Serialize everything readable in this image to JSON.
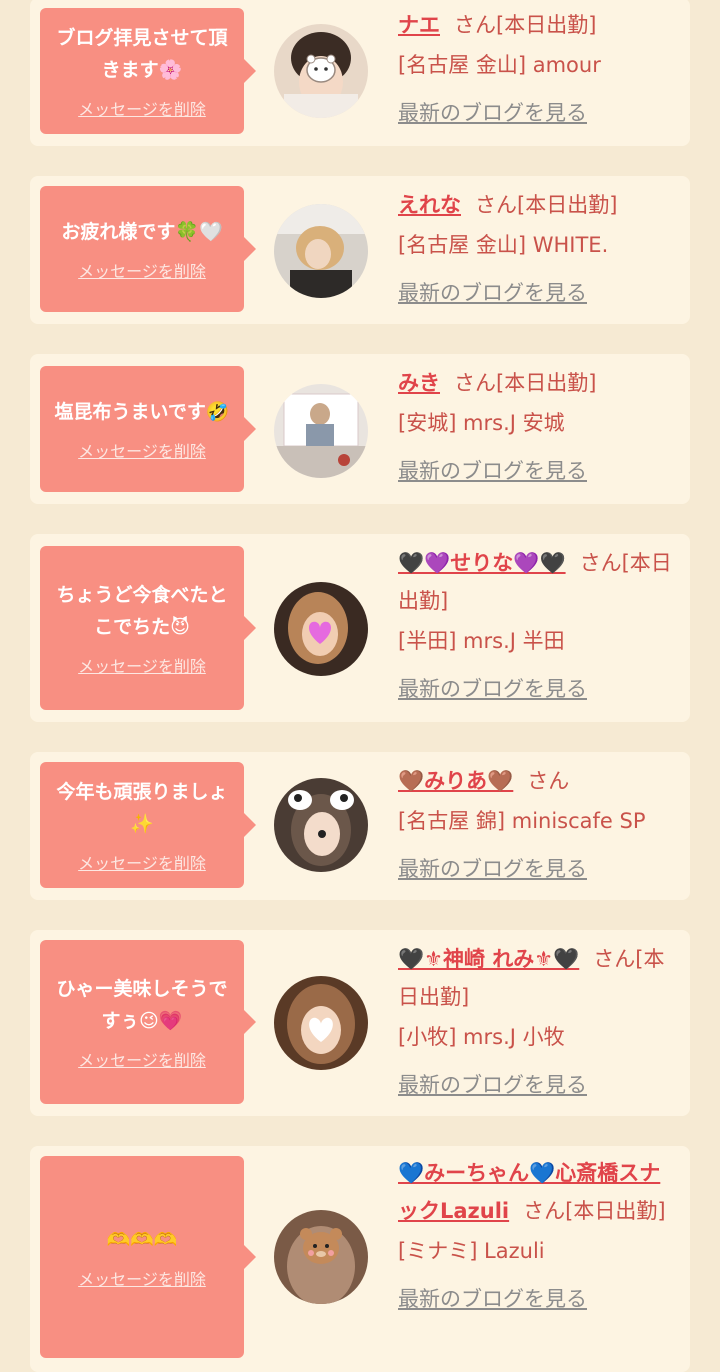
{
  "delete_label": "メッセージを削除",
  "blog_link_label": "最新のブログを見る",
  "san_label": "さん",
  "colors": {
    "page_bg": "#f6ead3",
    "card_bg": "#fdf4e2",
    "bubble": "#f88f82",
    "name": "#e0444a",
    "status": "#c9524a",
    "link": "#8c8c8c"
  },
  "cards": [
    {
      "message": "ブログ拝見させて頂きます🌸",
      "avatar_icon": "face-sticker-icon",
      "name": "ナエ",
      "status": "[本日出勤]",
      "shop": "[名古屋 金山] amour"
    },
    {
      "message": "お疲れ様です🍀🤍",
      "avatar_icon": "avatar-photo-icon",
      "name": "えれな",
      "status": "[本日出勤]",
      "shop": "[名古屋 金山] WHITE."
    },
    {
      "message": "塩昆布うまいです🤣",
      "avatar_icon": "avatar-photo-icon",
      "name": "みき",
      "status": "[本日出勤]",
      "shop": "[安城] mrs.J 安城"
    },
    {
      "message": "ちょうど今食べたとこでちた😈",
      "avatar_icon": "heart-sticker-icon",
      "name": "🖤💜せりな💜🖤",
      "status": "[本日出勤]",
      "shop": "[半田] mrs.J 半田"
    },
    {
      "message": "今年も頑張りましょ✨",
      "avatar_icon": "dog-ears-sticker-icon",
      "name": "🤎みりあ🤎",
      "status": "",
      "shop": "[名古屋 錦] miniscafe SP"
    },
    {
      "message": "ひゃー美味しそうですぅ😉💗",
      "avatar_icon": "heart-sticker-icon",
      "name": "🖤⚜神崎 れみ⚜🖤",
      "status": "[本日出勤]",
      "shop": "[小牧] mrs.J 小牧"
    },
    {
      "message": "🫶🫶🫶",
      "avatar_icon": "bear-sticker-icon",
      "name": "💙みーちゃん💙心斎橋スナックLazuli",
      "status": "[本日出勤]",
      "shop": "[ミナミ] Lazuli"
    }
  ]
}
